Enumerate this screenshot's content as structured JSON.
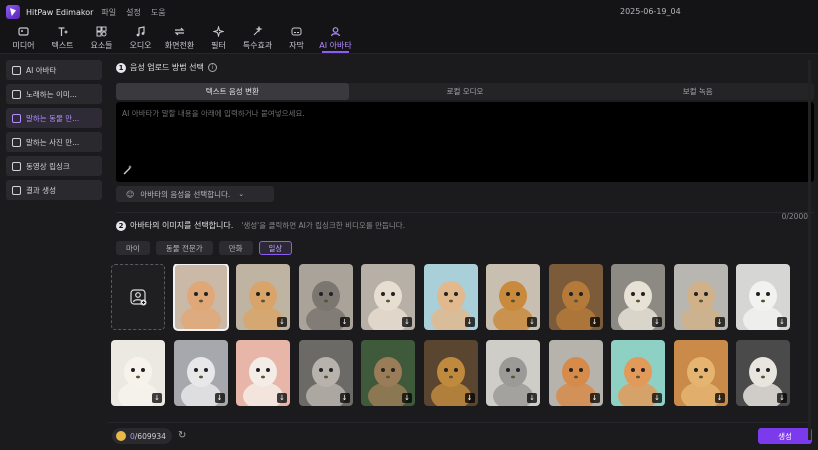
{
  "titlebar": {
    "app_name": "HitPaw Edimakor",
    "menu": [
      "파일",
      "설정",
      "도움"
    ],
    "project_name": "2025-06-19_04"
  },
  "toolbar": [
    {
      "label": "미디어",
      "icon": "media-icon"
    },
    {
      "label": "텍스트",
      "icon": "text-icon"
    },
    {
      "label": "요소들",
      "icon": "elements-icon"
    },
    {
      "label": "오디오",
      "icon": "audio-icon"
    },
    {
      "label": "화면전환",
      "icon": "transition-icon"
    },
    {
      "label": "필터",
      "icon": "filter-icon"
    },
    {
      "label": "특수효과",
      "icon": "effects-icon"
    },
    {
      "label": "자막",
      "icon": "subtitle-icon"
    },
    {
      "label": "AI 아바타",
      "icon": "ai-avatar-icon",
      "active": true
    }
  ],
  "sidebar": [
    {
      "label": "AI 아바타",
      "icon": "avatar-icon"
    },
    {
      "label": "노래하는 이미...",
      "icon": "image-icon"
    },
    {
      "label": "말하는 동물 만...",
      "icon": "animal-icon",
      "active": true
    },
    {
      "label": "말하는 사진 만...",
      "icon": "photo-icon"
    },
    {
      "label": "동영상 립싱크",
      "icon": "lipsync-icon"
    },
    {
      "label": "결과 생성",
      "icon": "result-icon"
    }
  ],
  "step1": {
    "num": "1",
    "title": "음성 업로드 방법 선택",
    "tabs": [
      "텍스트 음성 변환",
      "로컬 오디오",
      "보컬 녹음"
    ],
    "active_tab": 0,
    "placeholder": "AI 아바타가 말할 내용을 아래에 입력하거나 붙여넣으세요.",
    "count": "0/2000",
    "voice_label": "아바타의 음성을 선택합니다."
  },
  "step2": {
    "num": "2",
    "title": "아바타의 이미지를 선택합니다.",
    "hint": "'생성'을 클릭하면 AI가 립싱크한 비디오를 만듭니다.",
    "filters": [
      "마이",
      "동물 전문가",
      "만화",
      "일상"
    ],
    "active_filter": 3
  },
  "thumbs": [
    {
      "name": "cat-fluffy",
      "bg": "#c9b9a6",
      "fg": "#e0a878",
      "sel": true
    },
    {
      "name": "hamster",
      "bg": "#bfb3a2",
      "fg": "#d8a46a"
    },
    {
      "name": "cat-grey",
      "bg": "#a9a39a",
      "fg": "#7b7670"
    },
    {
      "name": "poodle",
      "bg": "#b7b0a6",
      "fg": "#e7ddd0"
    },
    {
      "name": "rabbit",
      "bg": "#a9cfd9",
      "fg": "#e2b88e"
    },
    {
      "name": "golden-retriever",
      "bg": "#c8bfb0",
      "fg": "#c98a3e"
    },
    {
      "name": "lion",
      "bg": "#7b5b3a",
      "fg": "#b57a3a"
    },
    {
      "name": "sheep",
      "bg": "#8d8a84",
      "fg": "#e8e2d6"
    },
    {
      "name": "deer",
      "bg": "#b7b6b0",
      "fg": "#d1b18a"
    },
    {
      "name": "white-wolf",
      "bg": "#d6d6d4",
      "fg": "#f2f2f0"
    },
    {
      "name": "samoyed",
      "bg": "#ece8e2",
      "fg": "#f7f3ec"
    },
    {
      "name": "ragdoll-cat",
      "bg": "#a6a8ad",
      "fg": "#e8e8ea"
    },
    {
      "name": "white-mouse",
      "bg": "#e8b6a8",
      "fg": "#f4ece6"
    },
    {
      "name": "black-sheep",
      "bg": "#6c6a66",
      "fg": "#b7b3ac"
    },
    {
      "name": "tabby-cat",
      "bg": "#3f5a3a",
      "fg": "#9a7c58"
    },
    {
      "name": "lion-face",
      "bg": "#5a4630",
      "fg": "#c08a3e"
    },
    {
      "name": "chinchilla",
      "bg": "#cfcdc8",
      "fg": "#9c9a96"
    },
    {
      "name": "ginger-cat",
      "bg": "#b6b2ac",
      "fg": "#d78b4a"
    },
    {
      "name": "orange-cat",
      "bg": "#8ed0c4",
      "fg": "#e29a5a"
    },
    {
      "name": "labrador",
      "bg": "#c98a4a",
      "fg": "#e5b471"
    },
    {
      "name": "maltese",
      "bg": "#4a4a4a",
      "fg": "#e8e4de"
    }
  ],
  "footer": {
    "credits_used": "0",
    "credits_total": "/609934",
    "generate_label": "생성"
  }
}
